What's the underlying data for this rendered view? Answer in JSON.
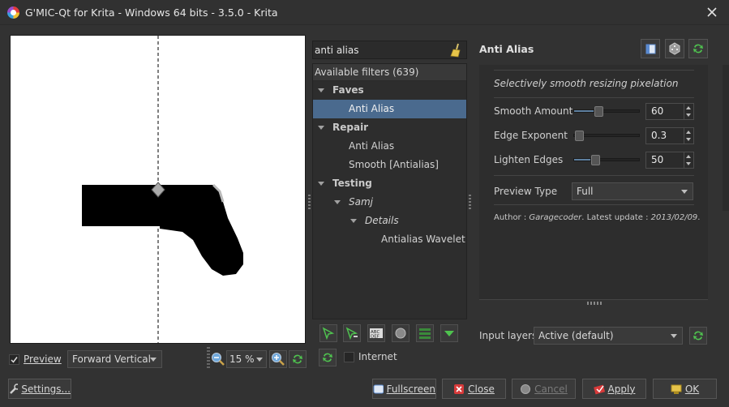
{
  "window": {
    "title": "G'MIC-Qt for Krita - Windows 64 bits - 3.5.0 - Krita",
    "close_icon": "close-icon"
  },
  "preview": {
    "checkbox_label": "Preview",
    "checked": true,
    "mode": "Forward Vertical",
    "zoom": "15 %"
  },
  "search": {
    "value": "anti alias",
    "clear_icon": "broom-icon"
  },
  "tree": {
    "header": "Available filters (639)",
    "items": [
      {
        "label": "Faves",
        "kind": "folder"
      },
      {
        "label": "Anti Alias",
        "kind": "filter",
        "selected": true
      },
      {
        "label": "Repair",
        "kind": "folder"
      },
      {
        "label": "Anti Alias",
        "kind": "filter"
      },
      {
        "label": "Smooth [Antialias]",
        "kind": "filter"
      },
      {
        "label": "Testing",
        "kind": "folder"
      },
      {
        "label": "Samj",
        "kind": "subfolder"
      },
      {
        "label": "Details",
        "kind": "subfolder"
      },
      {
        "label": "Antialias Wavelet",
        "kind": "filter"
      }
    ]
  },
  "internet": {
    "label": "Internet",
    "checked": false
  },
  "filter": {
    "title": "Anti Alias",
    "description": "Selectively smooth resizing pixelation",
    "params": [
      {
        "label": "Smooth Amount",
        "value": "60",
        "fraction": 0.3
      },
      {
        "label": "Edge Exponent",
        "value": "0.3",
        "fraction": 0.0
      },
      {
        "label": "Lighten Edges",
        "value": "50",
        "fraction": 0.25
      }
    ],
    "preview_type_label": "Preview Type",
    "preview_type_value": "Full",
    "author_prefix": "Author : ",
    "author_name": "Garagecoder",
    "update_prefix": ". Latest update : ",
    "update_date": "2013/02/09",
    "update_suffix": "."
  },
  "input_layers": {
    "label": "Input layers",
    "value": "Active (default)"
  },
  "buttons": {
    "settings": "Settings...",
    "fullscreen": "Fullscreen",
    "close": "Close",
    "cancel": "Cancel",
    "apply": "Apply",
    "ok": "OK"
  },
  "colors": {
    "background": "#323232",
    "selection": "#4a6a8e",
    "accent_green": "#4fc24f"
  }
}
